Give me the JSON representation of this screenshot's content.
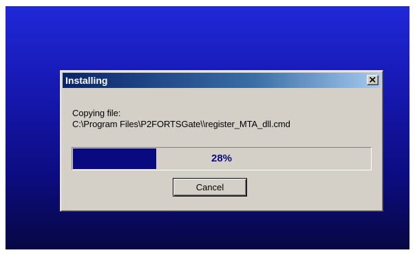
{
  "dialog": {
    "title": "Installing",
    "message_line1": "Copying file:",
    "message_line2": "C:\\Program Files\\P2FORTSGate\\\\register_MTA_dll.cmd",
    "progress": {
      "percent": 28,
      "label": "28%"
    },
    "cancel_label": "Cancel"
  },
  "icons": {
    "close": "close-icon"
  },
  "colors": {
    "desktop_top": "#2028d8",
    "desktop_bottom": "#070744",
    "titlebar_start": "#0a246a",
    "titlebar_end": "#a6caf0",
    "dialog_face": "#d4d0c8",
    "progress_fill": "#0a0a80"
  }
}
